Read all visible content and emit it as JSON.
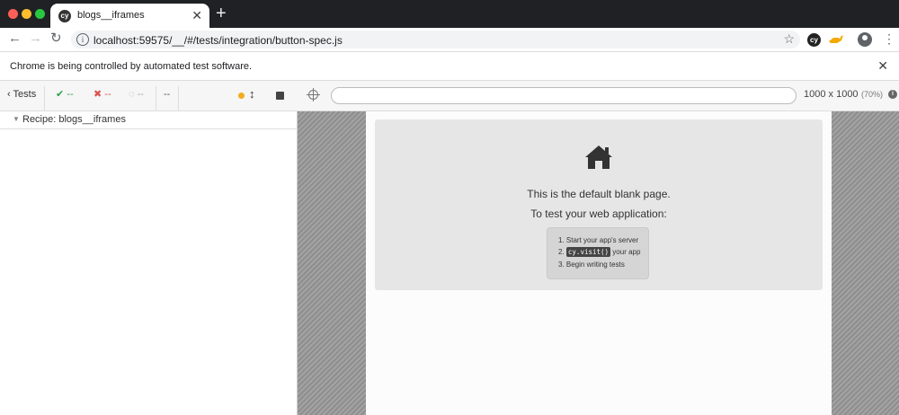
{
  "browser": {
    "tab_title": "blogs__iframes",
    "tab_favicon_text": "cy",
    "url": "localhost:59575/__/#/tests/integration/button-spec.js",
    "extension_text": "cy"
  },
  "infobar": {
    "message": "Chrome is being controlled by automated test software."
  },
  "reporter": {
    "tests_label": "Tests",
    "passed": "--",
    "failed": "--",
    "pending": "--",
    "duration": "--",
    "spec_name": "Recipe: blogs__iframes"
  },
  "aut": {
    "url_value": "",
    "viewport_dims": "1000 x 1000",
    "viewport_scale": "(70%)"
  },
  "blank_page": {
    "line1": "This is the default blank page.",
    "line2": "To test your web application:",
    "step1": "1. Start your app's server",
    "step2_prefix": "2.",
    "step2_code": "cy.visit()",
    "step2_suffix": "your app",
    "step3": "3. Begin writing tests"
  },
  "colors": {
    "pass": "#2aa34a",
    "fail": "#d9534f",
    "running_indicator": "#f0ad1e"
  },
  "icons": [
    "back-arrow-icon",
    "forward-arrow-icon",
    "reload-icon",
    "info-icon",
    "star-icon",
    "cypress-extension-icon",
    "extension-icon",
    "profile-icon",
    "menu-icon",
    "close-icon",
    "chevron-left-icon",
    "check-icon",
    "x-icon",
    "pending-circle-icon",
    "resize-arrow-icon",
    "stop-icon",
    "crosshair-icon",
    "home-icon"
  ]
}
